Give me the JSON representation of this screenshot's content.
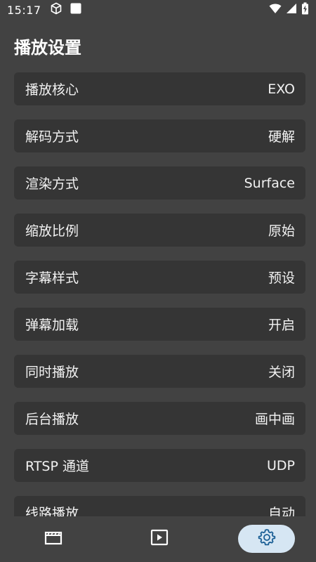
{
  "status_bar": {
    "time": "15:17",
    "icons": [
      "cube-icon",
      "square-notification-icon",
      "wifi-icon",
      "signal-icon",
      "battery-charging-icon"
    ]
  },
  "page": {
    "title": "播放设置"
  },
  "settings": [
    {
      "label": "播放核心",
      "value": "EXO"
    },
    {
      "label": "解码方式",
      "value": "硬解"
    },
    {
      "label": "渲染方式",
      "value": "Surface"
    },
    {
      "label": "缩放比例",
      "value": "原始"
    },
    {
      "label": "字幕样式",
      "value": "预设"
    },
    {
      "label": "弹幕加载",
      "value": "开启"
    },
    {
      "label": "同时播放",
      "value": "关闭"
    },
    {
      "label": "后台播放",
      "value": "画中画"
    },
    {
      "label": "RTSP 通道",
      "value": "UDP"
    },
    {
      "label": "线路播放",
      "value": "自动"
    }
  ],
  "bottom_nav": {
    "items": [
      {
        "name": "video-library",
        "icon": "clapperboard-icon",
        "selected": false
      },
      {
        "name": "player",
        "icon": "play-icon",
        "selected": false
      },
      {
        "name": "settings",
        "icon": "gear-icon",
        "selected": true
      }
    ],
    "selected_color": "#d6e6f3",
    "selected_icon_color": "#1b5f95"
  },
  "colors": {
    "background": "#424242",
    "item_background": "#353535",
    "text": "#f2f2f2"
  }
}
